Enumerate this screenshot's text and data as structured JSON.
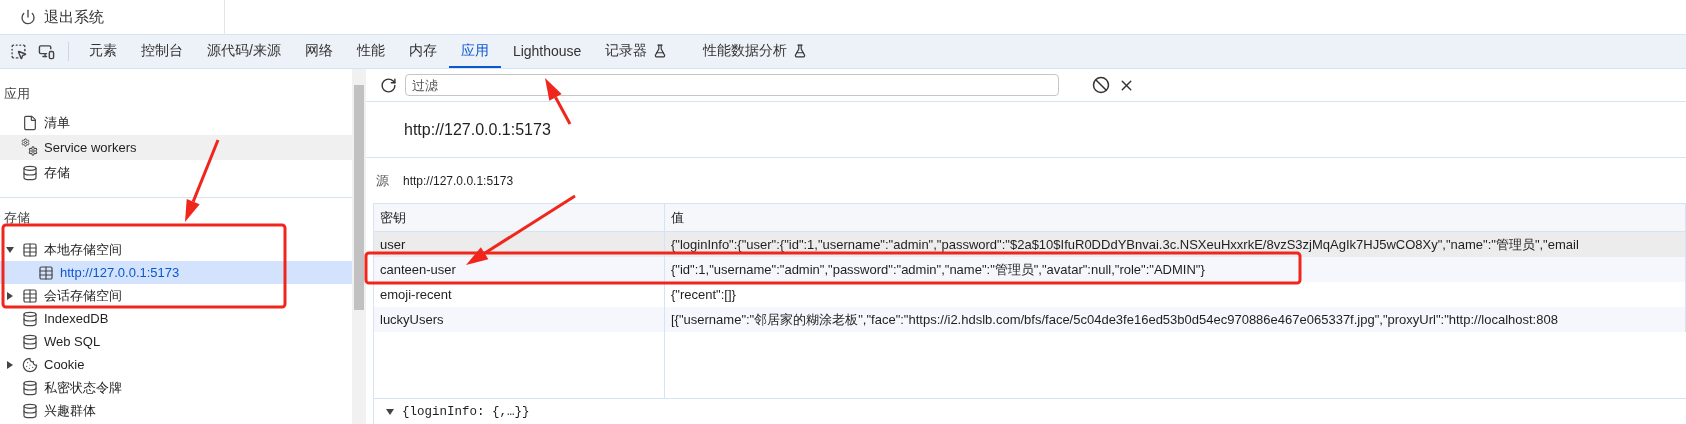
{
  "page": {
    "logout_label": "退出系统"
  },
  "devtools": {
    "tabs": [
      {
        "label": "元素",
        "selected": false,
        "experimental": false
      },
      {
        "label": "控制台",
        "selected": false,
        "experimental": false
      },
      {
        "label": "源代码/来源",
        "selected": false,
        "experimental": false
      },
      {
        "label": "网络",
        "selected": false,
        "experimental": false
      },
      {
        "label": "性能",
        "selected": false,
        "experimental": false
      },
      {
        "label": "内存",
        "selected": false,
        "experimental": false
      },
      {
        "label": "应用",
        "selected": true,
        "experimental": false
      },
      {
        "label": "Lighthouse",
        "selected": false,
        "experimental": false
      },
      {
        "label": "记录器",
        "selected": false,
        "experimental": true
      },
      {
        "label": "性能数据分析",
        "selected": false,
        "experimental": true
      }
    ]
  },
  "sidebar": {
    "sections": [
      {
        "title": "应用",
        "items": [
          {
            "label": "清单",
            "kind": "document",
            "selected": false,
            "hovered": false
          },
          {
            "label": "Service workers",
            "kind": "worker",
            "selected": false,
            "hovered": true
          },
          {
            "label": "存储",
            "kind": "database",
            "selected": false,
            "hovered": false
          }
        ]
      },
      {
        "title": "存储",
        "items": [
          {
            "label": "本地存储空间",
            "kind": "table",
            "selected": false,
            "hovered": false,
            "expanded": true,
            "children": [
              {
                "label": "http://127.0.0.1:5173",
                "kind": "table",
                "selected": true
              }
            ]
          },
          {
            "label": "会话存储空间",
            "kind": "table",
            "selected": false,
            "hovered": false,
            "expanded": false
          },
          {
            "label": "IndexedDB",
            "kind": "database",
            "selected": false,
            "hovered": false
          },
          {
            "label": "Web SQL",
            "kind": "database",
            "selected": false,
            "hovered": false
          },
          {
            "label": "Cookie",
            "kind": "cookie",
            "selected": false,
            "hovered": false,
            "expanded": false
          },
          {
            "label": "私密状态令牌",
            "kind": "database",
            "selected": false,
            "hovered": false
          },
          {
            "label": "兴趣群体",
            "kind": "database",
            "selected": false,
            "hovered": false
          }
        ]
      }
    ]
  },
  "filter": {
    "placeholder": "过滤"
  },
  "origin_title": "http://127.0.0.1:5173",
  "origin_row": {
    "label": "源",
    "value": "http://127.0.0.1:5173"
  },
  "table": {
    "columns": [
      "密钥",
      "值"
    ],
    "rows": [
      {
        "key": "user",
        "value": "{\"loginInfo\":{\"user\":{\"id\":1,\"username\":\"admin\",\"password\":\"$2a$10$IfuR0DDdYBnvai.3c.NSXeuHxxrkE/8vzS3zjMqAgIk7HJ5wCO8Xy\",\"name\":\"管理员\",\"email",
        "selected": true
      },
      {
        "key": "canteen-user",
        "value": "{\"id\":1,\"username\":\"admin\",\"password\":\"admin\",\"name\":\"管理员\",\"avatar\":null,\"role\":\"ADMIN\"}",
        "selected": false
      },
      {
        "key": "emoji-recent",
        "value": "{\"recent\":[]}",
        "selected": false
      },
      {
        "key": "luckyUsers",
        "value": "[{\"username\":\"邻居家的糊涂老板\",\"face\":\"https://i2.hdslb.com/bfs/face/5c04de3fe16ed53b0d54ec970886e467e065337f.jpg\",\"proxyUrl\":\"http://localhost:808",
        "selected": false
      }
    ]
  },
  "preview": {
    "expanded": true,
    "text": "{loginInfo: {,…}}"
  }
}
